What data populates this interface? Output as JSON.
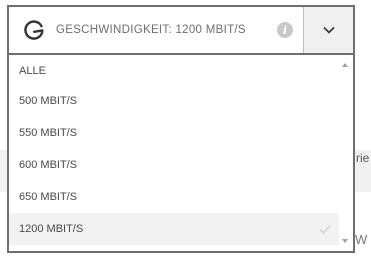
{
  "background": {
    "clipped_text_1": "rie",
    "clipped_text_2": "W"
  },
  "select": {
    "brand_icon": "g-speed-icon",
    "label": "GESCHWINDIGKEIT: 1200 MBIT/S",
    "info_icon_glyph": "i",
    "toggle_icon": "chevron-down-icon"
  },
  "dropdown": {
    "options": [
      {
        "label": "ALLE"
      },
      {
        "label": "500 MBIT/S"
      },
      {
        "label": "550 MBIT/S"
      },
      {
        "label": "600 MBIT/S"
      },
      {
        "label": "650 MBIT/S"
      },
      {
        "label": "1200 MBIT/S",
        "selected": true
      }
    ],
    "selected_index": 5
  },
  "colors": {
    "border": "#6f6f6f",
    "selected_bg": "#f2f2f2",
    "text": "#4a4a4a",
    "label_text": "#6e6e6e"
  }
}
